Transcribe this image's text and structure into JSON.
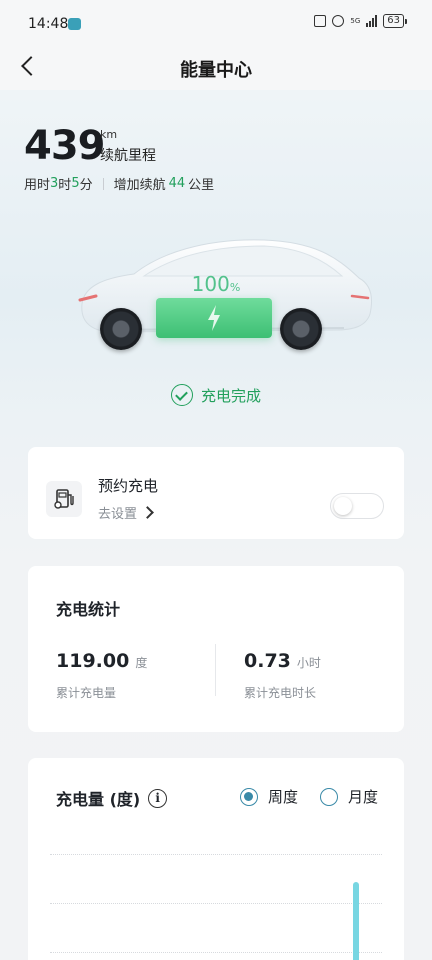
{
  "status_bar": {
    "time": "14:48",
    "network": "5G",
    "battery": "63"
  },
  "header": {
    "title": "能量中心",
    "back_icon": "chevron-left-icon"
  },
  "range": {
    "value": "439",
    "unit": "km",
    "label": "续航里程",
    "time_prefix": "用时",
    "hours": "3",
    "hours_unit": "时",
    "minutes": "5",
    "minutes_unit": "分",
    "added_prefix": "增加续航",
    "added_value": "44",
    "added_unit": "公里"
  },
  "battery": {
    "percent": "100",
    "percent_unit": "%",
    "level": 1.0,
    "status": "充电完成"
  },
  "schedule": {
    "title": "预约充电",
    "link": "去设置",
    "toggle_on": false
  },
  "stats": {
    "title": "充电统计",
    "items": [
      {
        "value": "119.00",
        "unit": "度",
        "label": "累计充电量"
      },
      {
        "value": "0.73",
        "unit": "小时",
        "label": "累计充电时长"
      }
    ]
  },
  "chart_panel": {
    "title": "充电量 (度)",
    "info_icon": "info-icon",
    "options": [
      {
        "label": "周度",
        "selected": true
      },
      {
        "label": "月度",
        "selected": false
      }
    ]
  },
  "colors": {
    "accent_green": "#22a05c",
    "battery_green": "#3dbf74",
    "radio_teal": "#3a8aa8",
    "bar_cyan": "#78d6e2"
  }
}
